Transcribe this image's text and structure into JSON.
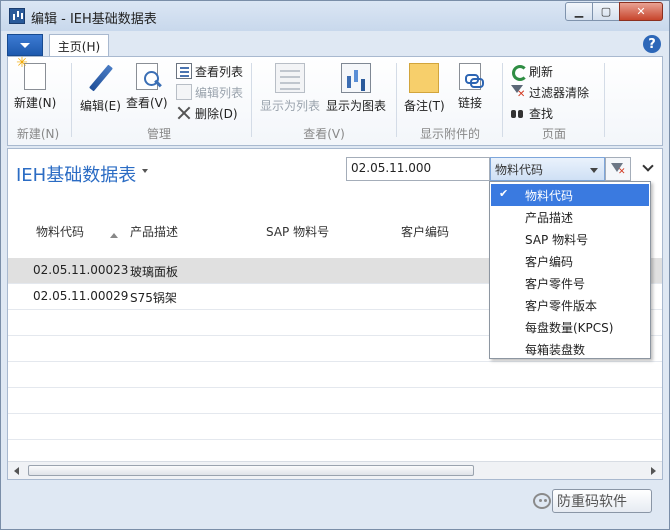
{
  "window": {
    "title": "编辑 - IEH基础数据表"
  },
  "ribbon": {
    "tab_home": "主页(H)",
    "groups": {
      "new": {
        "label": "新建(N)",
        "new_btn": "新建(N)"
      },
      "manage": {
        "label": "管理",
        "edit_btn": "编辑(E)",
        "view_btn": "查看(V)",
        "view_list": "查看列表",
        "edit_list": "编辑列表",
        "delete": "删除(D)"
      },
      "view": {
        "label": "查看(V)",
        "show_list": "显示为列表",
        "show_chart": "显示为图表"
      },
      "attachments": {
        "label": "显示附件的",
        "notes": "备注(T)",
        "links": "链接"
      },
      "page": {
        "label": "页面",
        "refresh": "刷新",
        "clear_filter": "过滤器清除",
        "find": "查找"
      }
    }
  },
  "content": {
    "title": "IEH基础数据表",
    "search_value": "02.05.11.000",
    "field_selected": "物料代码",
    "columns": [
      "物料代码",
      "产品描述",
      "SAP 物料号",
      "客户编码"
    ],
    "rows": [
      {
        "code": "02.05.11.00023",
        "desc": "玻璃面板"
      },
      {
        "code": "02.05.11.00029",
        "desc": "S75锅架"
      }
    ],
    "field_options": [
      {
        "label": "物料代码",
        "checked": true
      },
      {
        "label": "产品描述"
      },
      {
        "label": "SAP 物料号"
      },
      {
        "label": "客户编码"
      },
      {
        "label": "客户零件号"
      },
      {
        "label": "客户零件版本"
      },
      {
        "label": "每盘数量(KPCS)"
      },
      {
        "label": "每箱装盘数"
      }
    ]
  },
  "watermark": "防重码软件"
}
